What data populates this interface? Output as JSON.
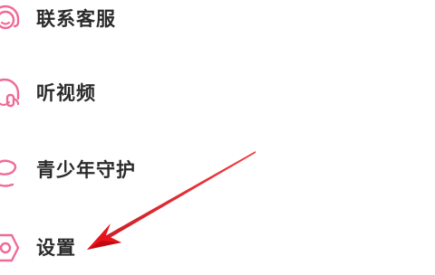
{
  "menu": {
    "items": [
      {
        "label": "联系客服",
        "icon": "customer-service-icon"
      },
      {
        "label": "听视频",
        "icon": "headphones-icon"
      },
      {
        "label": "青少年守护",
        "icon": "youth-guard-icon"
      },
      {
        "label": "设置",
        "icon": "settings-icon"
      }
    ]
  },
  "colors": {
    "icon": "#f06a97",
    "label": "#2b2b2b",
    "arrow": "#e8141c"
  }
}
